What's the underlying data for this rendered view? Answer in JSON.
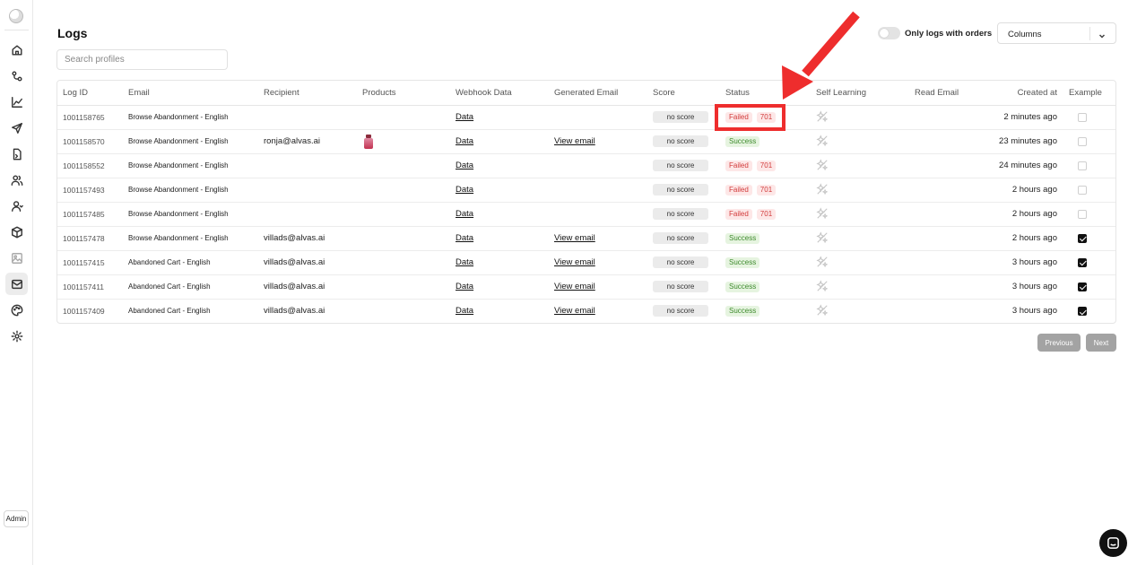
{
  "page": {
    "title": "Logs"
  },
  "search": {
    "placeholder": "Search profiles"
  },
  "filters": {
    "toggle_label": "Only logs with orders",
    "columns_label": "Columns"
  },
  "sidebar": {
    "items": [
      {
        "name": "home-icon"
      },
      {
        "name": "flows-icon"
      },
      {
        "name": "analytics-icon"
      },
      {
        "name": "send-icon"
      },
      {
        "name": "import-icon"
      },
      {
        "name": "profiles-icon"
      },
      {
        "name": "segments-icon"
      },
      {
        "name": "products-icon"
      },
      {
        "name": "images-icon"
      },
      {
        "name": "logs-icon",
        "active": true
      },
      {
        "name": "palette-icon"
      },
      {
        "name": "settings-icon"
      }
    ],
    "admin_label": "Admin"
  },
  "table": {
    "headers": {
      "log_id": "Log ID",
      "email": "Email",
      "recipient": "Recipient",
      "products": "Products",
      "webhook": "Webhook Data",
      "generated": "Generated Email",
      "score": "Score",
      "status": "Status",
      "self_learning": "Self Learning",
      "read_email": "Read Email",
      "created": "Created at",
      "example": "Example"
    },
    "rows": [
      {
        "log_id": "1001158765",
        "email": "Browse Abandonment - English",
        "recipient": "",
        "has_product": false,
        "webhook": "Data",
        "generated": "",
        "score": "no score",
        "status": "Failed",
        "code": "701",
        "created": "2 minutes ago",
        "example": false
      },
      {
        "log_id": "1001158570",
        "email": "Browse Abandonment - English",
        "recipient": "ronja@alvas.ai",
        "has_product": true,
        "webhook": "Data",
        "generated": "View email",
        "score": "no score",
        "status": "Success",
        "code": "",
        "created": "23 minutes ago",
        "example": false
      },
      {
        "log_id": "1001158552",
        "email": "Browse Abandonment - English",
        "recipient": "",
        "has_product": false,
        "webhook": "Data",
        "generated": "",
        "score": "no score",
        "status": "Failed",
        "code": "701",
        "created": "24 minutes ago",
        "example": false
      },
      {
        "log_id": "1001157493",
        "email": "Browse Abandonment - English",
        "recipient": "",
        "has_product": false,
        "webhook": "Data",
        "generated": "",
        "score": "no score",
        "status": "Failed",
        "code": "701",
        "created": "2 hours ago",
        "example": false
      },
      {
        "log_id": "1001157485",
        "email": "Browse Abandonment - English",
        "recipient": "",
        "has_product": false,
        "webhook": "Data",
        "generated": "",
        "score": "no score",
        "status": "Failed",
        "code": "701",
        "created": "2 hours ago",
        "example": false
      },
      {
        "log_id": "1001157478",
        "email": "Browse Abandonment - English",
        "recipient": "villads@alvas.ai",
        "has_product": false,
        "webhook": "Data",
        "generated": "View email",
        "score": "no score",
        "status": "Success",
        "code": "",
        "created": "2 hours ago",
        "example": true
      },
      {
        "log_id": "1001157415",
        "email": "Abandoned Cart - English",
        "recipient": "villads@alvas.ai",
        "has_product": false,
        "webhook": "Data",
        "generated": "View email",
        "score": "no score",
        "status": "Success",
        "code": "",
        "created": "3 hours ago",
        "example": true
      },
      {
        "log_id": "1001157411",
        "email": "Abandoned Cart - English",
        "recipient": "villads@alvas.ai",
        "has_product": false,
        "webhook": "Data",
        "generated": "View email",
        "score": "no score",
        "status": "Success",
        "code": "",
        "created": "3 hours ago",
        "example": true
      },
      {
        "log_id": "1001157409",
        "email": "Abandoned Cart - English",
        "recipient": "villads@alvas.ai",
        "has_product": false,
        "webhook": "Data",
        "generated": "View email",
        "score": "no score",
        "status": "Success",
        "code": "",
        "created": "3 hours ago",
        "example": true
      }
    ]
  },
  "pagination": {
    "previous": "Previous",
    "next": "Next"
  },
  "colors": {
    "failed": "#d23b3b",
    "success": "#3d8a2c",
    "highlight": "#ee2d2d"
  }
}
